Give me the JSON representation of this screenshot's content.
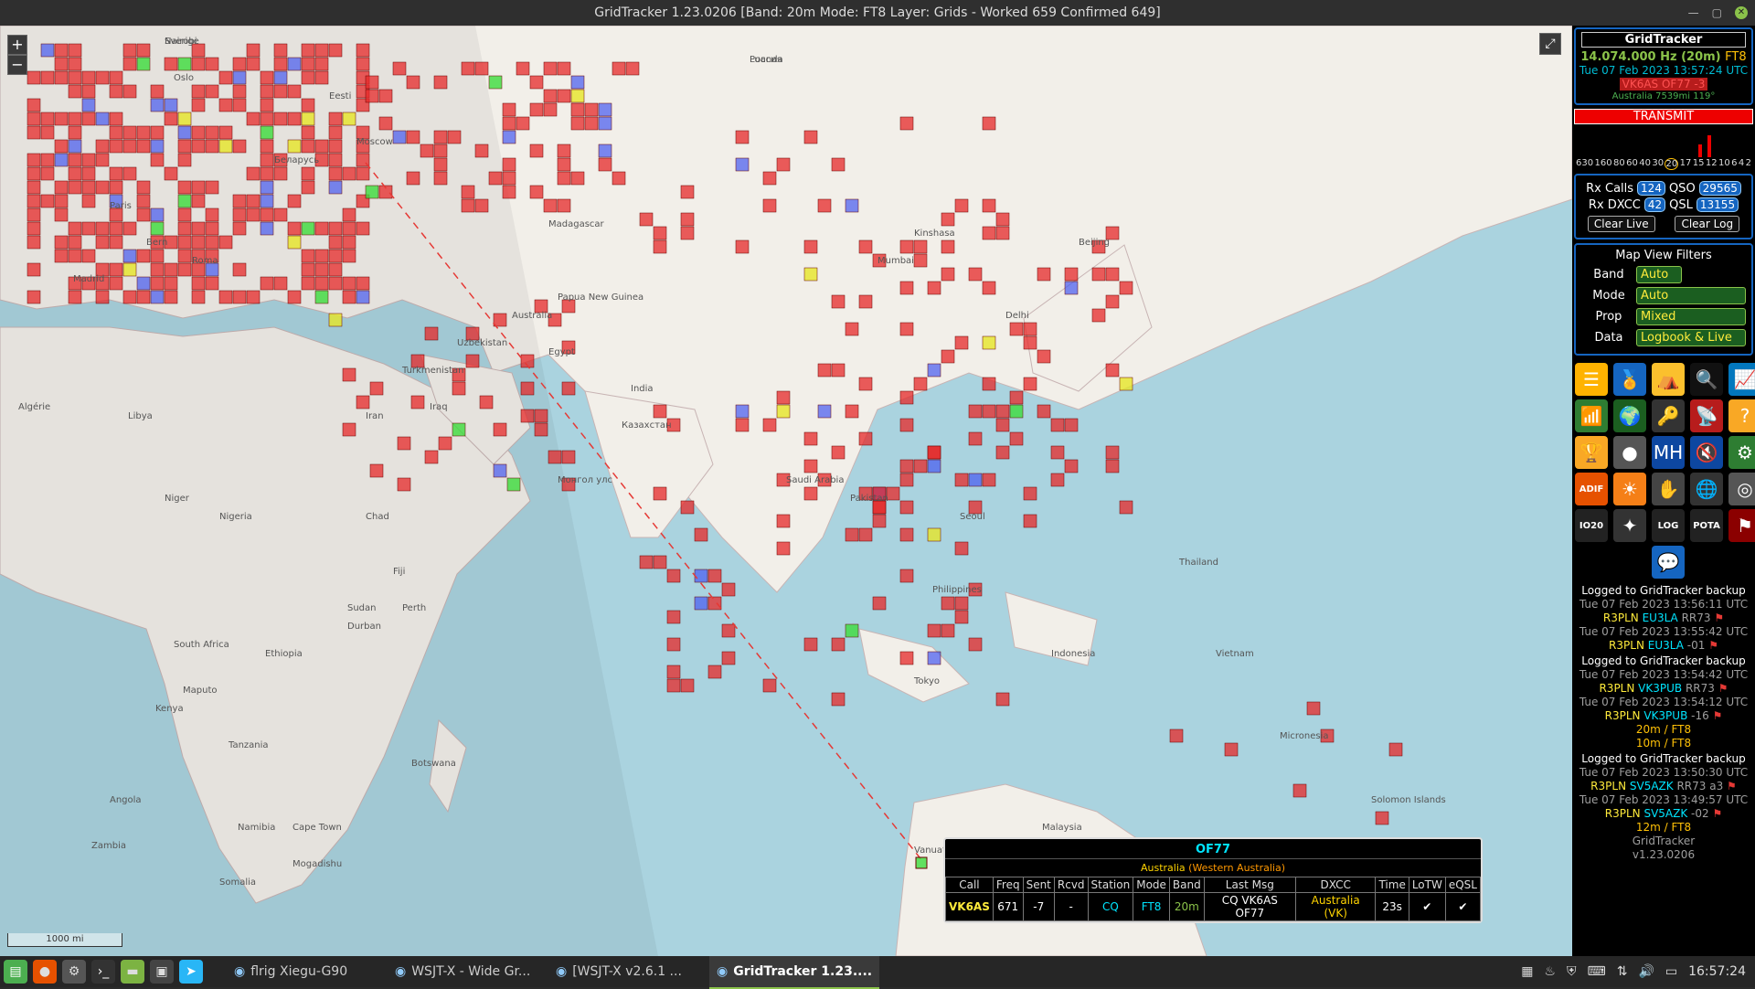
{
  "window": {
    "title": "GridTracker 1.23.0206 [Band: 20m Mode: FT8 Layer: Grids - Worked 659 Confirmed 649]"
  },
  "map": {
    "zoom_in": "+",
    "zoom_out": "−",
    "fullscreen": "⤢",
    "scale": "1000 mi",
    "labels": [
      {
        "t": "Sverige"
      },
      {
        "t": "Россия"
      },
      {
        "t": "Oslo"
      },
      {
        "t": "Eesti"
      },
      {
        "t": "Moscow"
      },
      {
        "t": "Беларусь"
      },
      {
        "t": "Paris"
      },
      {
        "t": "Bern"
      },
      {
        "t": "Roma"
      },
      {
        "t": "Madrid"
      },
      {
        "t": "Algérie"
      },
      {
        "t": "Libya"
      },
      {
        "t": "Niger"
      },
      {
        "t": "Nigeria"
      },
      {
        "t": "Chad"
      },
      {
        "t": "Sudan"
      },
      {
        "t": "Ethiopia"
      },
      {
        "t": "Kenya"
      },
      {
        "t": "Tanzania"
      },
      {
        "t": "Angola"
      },
      {
        "t": "Zambia"
      },
      {
        "t": "Namibia"
      },
      {
        "t": "Botswana"
      },
      {
        "t": "South Africa"
      },
      {
        "t": "Madagascar"
      },
      {
        "t": "Kinshasa"
      },
      {
        "t": "Казахстан"
      },
      {
        "t": "Монгол улс"
      },
      {
        "t": "India"
      },
      {
        "t": "Mumbai"
      },
      {
        "t": "Delhi"
      },
      {
        "t": "Beijing"
      },
      {
        "t": "Seoul"
      },
      {
        "t": "Tokyo"
      },
      {
        "t": "Philippines"
      },
      {
        "t": "Indonesia"
      },
      {
        "t": "Malaysia"
      },
      {
        "t": "Papua New Guinea"
      },
      {
        "t": "Australia"
      },
      {
        "t": "Uzbekistan"
      },
      {
        "t": "Turkmenistan"
      },
      {
        "t": "Iran"
      },
      {
        "t": "Iraq"
      },
      {
        "t": "Egypt"
      },
      {
        "t": "Saudi Arabia"
      },
      {
        "t": "Pakistan"
      },
      {
        "t": "Thailand"
      },
      {
        "t": "Vietnam"
      },
      {
        "t": "Micronesia"
      },
      {
        "t": "Solomon Islands"
      },
      {
        "t": "Vanuatu"
      },
      {
        "t": "Fiji"
      },
      {
        "t": "Perth"
      },
      {
        "t": "Somalia"
      },
      {
        "t": "Mogadishu"
      },
      {
        "t": "Cape Town"
      },
      {
        "t": "Durban"
      },
      {
        "t": "Maputo"
      },
      {
        "t": "Nairobi"
      },
      {
        "t": "Luanda"
      }
    ]
  },
  "popup": {
    "grid": "OF77",
    "country": "Australia",
    "state": "(Western Australia)",
    "headers": [
      "Call",
      "Freq",
      "Sent",
      "Rcvd",
      "Station",
      "Mode",
      "Band",
      "Last Msg",
      "DXCC",
      "Time",
      "LoTW",
      "eQSL"
    ],
    "row": [
      "VK6AS",
      "671",
      "-7",
      "-",
      "CQ",
      "FT8",
      "20m",
      "CQ VK6AS OF77",
      "Australia (VK)",
      "23s",
      "✔",
      "✔"
    ]
  },
  "side": {
    "app": "GridTracker",
    "freq": "14.074.000 Hz (20m)",
    "mode": "FT8",
    "datetime": "Tue 07 Feb 2023 13:57:24 UTC",
    "call_grid": "VK6AS OF77 -3",
    "distance": "Australia 7539mi 119°",
    "transmit": "TRANSMIT",
    "bands": [
      "630",
      "160",
      "80",
      "60",
      "40",
      "30",
      "20",
      "17",
      "15",
      "12",
      "10",
      "6",
      "4",
      "2"
    ],
    "rx_calls_label": "Rx Calls",
    "rx_calls": "124",
    "qso_label": "QSO",
    "qso": "29565",
    "rx_dxcc_label": "Rx DXCC",
    "rx_dxcc": "42",
    "qsl_label": "QSL",
    "qsl": "13155",
    "clear_live": "Clear Live",
    "clear_log": "Clear Log",
    "filters_title": "Map View Filters",
    "filters": [
      {
        "label": "Band",
        "value": "Auto"
      },
      {
        "label": "Mode",
        "value": "Auto"
      },
      {
        "label": "Prop",
        "value": "Mixed"
      },
      {
        "label": "Data",
        "value": "Logbook & Live"
      }
    ],
    "icons": [
      {
        "name": "logbook-icon",
        "glyph": "☰",
        "bg": "#ffb300"
      },
      {
        "name": "award-medal-icon",
        "glyph": "🏅",
        "bg": "#1565c0"
      },
      {
        "name": "pota-tent-icon",
        "glyph": "⛺",
        "bg": "#fbc02d"
      },
      {
        "name": "lookup-magnifier-icon",
        "glyph": "🔍",
        "bg": "#111"
      },
      {
        "name": "chart-icon",
        "glyph": "📈",
        "bg": "#0277bd"
      },
      {
        "name": "wifi-icon",
        "glyph": "📶",
        "bg": "#2e7d32"
      },
      {
        "name": "globe-icon",
        "glyph": "🌍",
        "bg": "#1b5e20"
      },
      {
        "name": "key-icon",
        "glyph": "🔑",
        "bg": "#333"
      },
      {
        "name": "radio-tower-icon",
        "glyph": "📡",
        "bg": "#b71c1c"
      },
      {
        "name": "help-icon",
        "glyph": "?",
        "bg": "#f9a825"
      },
      {
        "name": "trophy-icon",
        "glyph": "🏆",
        "bg": "#f9a825"
      },
      {
        "name": "moon-icon",
        "glyph": "●",
        "bg": "#555"
      },
      {
        "name": "mh-icon",
        "glyph": "MH",
        "bg": "#0d47a1"
      },
      {
        "name": "mute-icon",
        "glyph": "🔇",
        "bg": "#0d47a1"
      },
      {
        "name": "settings-gear-icon",
        "glyph": "⚙",
        "bg": "#2e7d32"
      },
      {
        "name": "adif-icon",
        "glyph": "ADIF",
        "bg": "#e65100"
      },
      {
        "name": "sun-icon",
        "glyph": "☀",
        "bg": "#f57f17"
      },
      {
        "name": "hand-icon",
        "glyph": "✋",
        "bg": "#444"
      },
      {
        "name": "web-globe-icon",
        "glyph": "🌐",
        "bg": "#333"
      },
      {
        "name": "radar-icon",
        "glyph": "◎",
        "bg": "#555"
      },
      {
        "name": "grid-square-icon",
        "glyph": "IO20",
        "bg": "#222"
      },
      {
        "name": "satellite-icon",
        "glyph": "✦",
        "bg": "#333"
      },
      {
        "name": "lotw-icon",
        "glyph": "LOG",
        "bg": "#222"
      },
      {
        "name": "pota-icon",
        "glyph": "POTA",
        "bg": "#222"
      },
      {
        "name": "flag-icon",
        "glyph": "⚑",
        "bg": "#8b0000"
      },
      {
        "name": "chat-icon",
        "glyph": "💬",
        "bg": "#1565c0"
      }
    ],
    "log": [
      {
        "hdr": "Logged to GridTracker backup"
      },
      {
        "ts": "Tue 07 Feb 2023 13:56:11 UTC",
        "me": "R3PLN",
        "call": "EU3LA",
        "msg": "RR73"
      },
      {
        "ts": "Tue 07 Feb 2023 13:55:42 UTC",
        "me": "R3PLN",
        "call": "EU3LA",
        "msg": "-01"
      },
      {
        "hdr": "Logged to GridTracker backup"
      },
      {
        "ts": "Tue 07 Feb 2023 13:54:42 UTC",
        "me": "R3PLN",
        "call": "VK3PUB",
        "msg": "RR73"
      },
      {
        "ts": "Tue 07 Feb 2023 13:54:12 UTC",
        "me": "R3PLN",
        "call": "VK3PUB",
        "msg": "-16"
      },
      {
        "band": "20m / FT8"
      },
      {
        "band": "10m / FT8"
      },
      {
        "hdr": "Logged to GridTracker backup"
      },
      {
        "ts": "Tue 07 Feb 2023 13:50:30 UTC",
        "me": "R3PLN",
        "call": "SV5AZK",
        "msg": "RR73 a3"
      },
      {
        "ts": "Tue 07 Feb 2023 13:49:57 UTC",
        "me": "R3PLN",
        "call": "SV5AZK",
        "msg": "-02"
      },
      {
        "band": "12m / FT8"
      }
    ],
    "footer_app": "GridTracker",
    "footer_ver": "v1.23.0206"
  },
  "taskbar": {
    "tasks": [
      {
        "label": "flrig Xiegu-G90",
        "active": false
      },
      {
        "label": "WSJT-X - Wide Gr...",
        "active": false
      },
      {
        "label": "[WSJT-X  v2.6.1  ...",
        "active": false
      },
      {
        "label": "GridTracker 1.23....",
        "active": true
      }
    ],
    "clock": "16:57:24"
  }
}
